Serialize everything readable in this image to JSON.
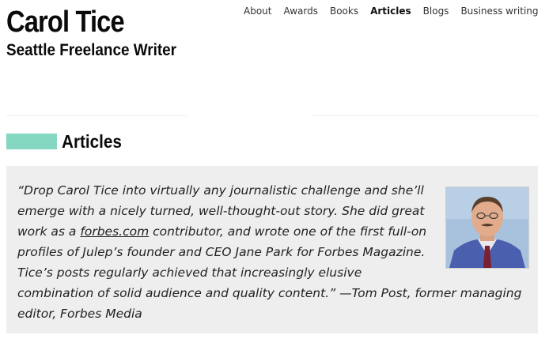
{
  "site": {
    "title": "Carol Tice",
    "subtitle": "Seattle Freelance Writer"
  },
  "nav": {
    "items": [
      {
        "label": "About"
      },
      {
        "label": "Awards"
      },
      {
        "label": "Books"
      },
      {
        "label": "Articles",
        "active": true
      },
      {
        "label": "Blogs"
      },
      {
        "label": "Business writing"
      }
    ]
  },
  "section": {
    "title": "Articles",
    "accent_color": "#84d7c0"
  },
  "testimonial": {
    "quote_before_link": "“Drop Carol Tice into virtually any journalistic challenge and she’ll emerge with a nicely turned, well-thought-out story. She did great work as a ",
    "link_text": "forbes.com",
    "quote_after_link": " contributor, and wrote one of the first full-on profiles of Julep’s founder and CEO Jane Park for Forbes Magazine. Tice’s posts regularly achieved that in­creasingly elusive combination of solid audience and quality content.” —Tom Post, former managing editor, Forbes Media",
    "photo_icon": "person-photo"
  }
}
